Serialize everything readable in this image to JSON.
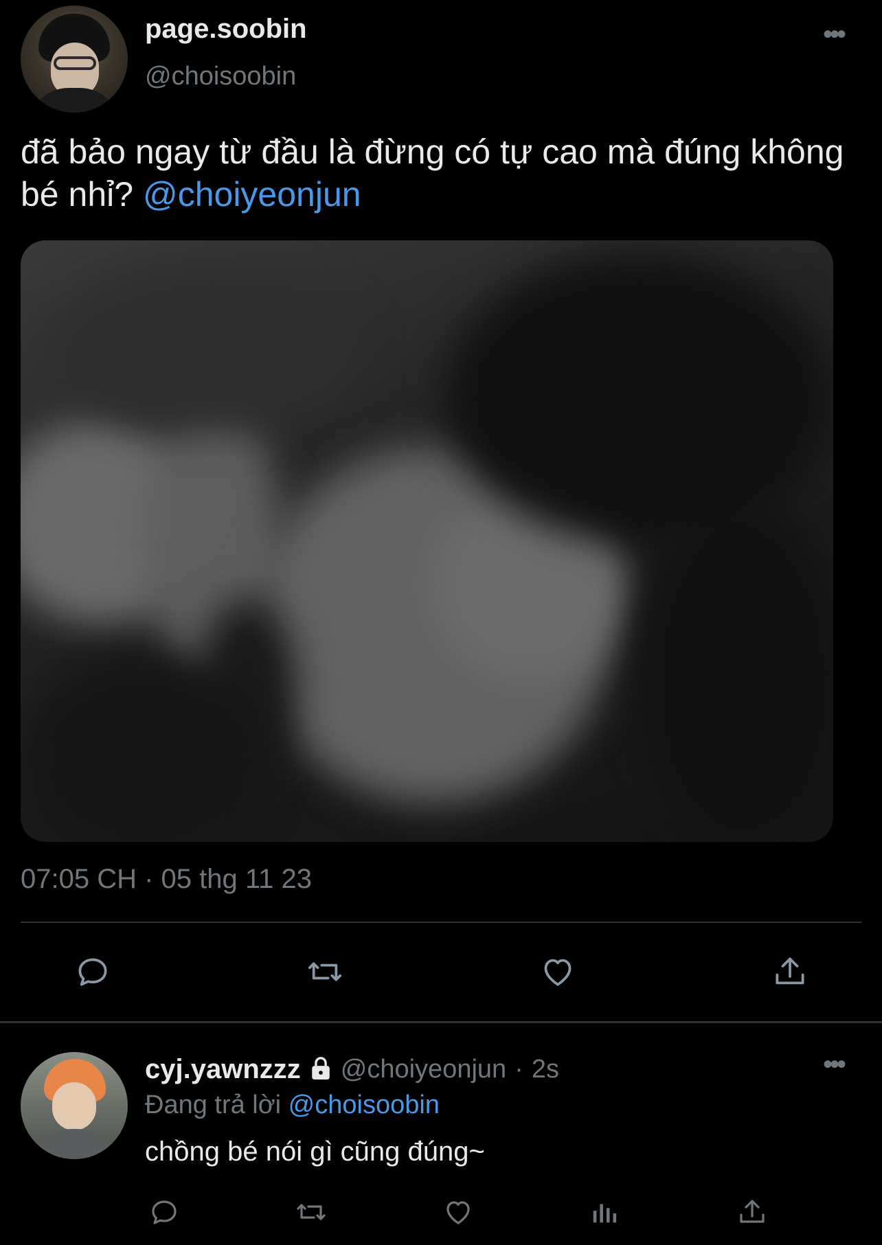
{
  "main_tweet": {
    "display_name": "page.soobin",
    "handle": "@choisoobin",
    "more_label": "•••",
    "text": "đã bảo ngay từ đầu là đừng có tự cao mà đúng không bé nhỉ?",
    "mention": "@choiyeonjun",
    "timestamp": "07:05 CH · 05 thg 11 23",
    "actions": [
      "reply-icon",
      "retweet-icon",
      "like-icon",
      "share-icon"
    ]
  },
  "reply": {
    "display_name": "cyj.yawnzzz",
    "handle": "@choiyeonjun",
    "separator": "·",
    "time": "2s",
    "more_label": "•••",
    "replying_to_prefix": "Đang trả lời",
    "replying_to_handle": "@choisoobin",
    "text": "chồng bé nói gì cũng đúng~",
    "actions": [
      "reply-icon",
      "retweet-icon",
      "like-icon",
      "views-icon",
      "share-icon"
    ]
  },
  "colors": {
    "background": "#000000",
    "text_primary": "#e7e9ea",
    "text_secondary": "#71767b",
    "accent": "#4a99e9",
    "divider": "#2f3336"
  }
}
